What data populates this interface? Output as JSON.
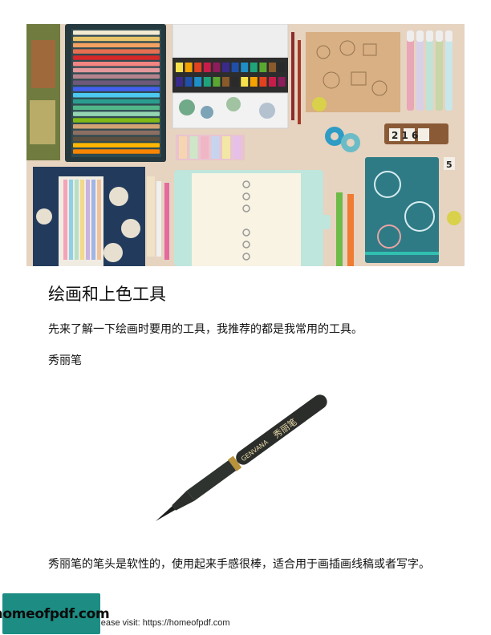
{
  "content": {
    "heading": "绘画和上色工具",
    "intro": "先来了解一下绘画时要用的工具，我推荐的都是我常用的工具。",
    "pen_name": "秀丽笔",
    "pen_description": "秀丽笔的笔头是软性的，使用起来手感很棒，适合用于画插画线稿或者写字。"
  },
  "pen_image": {
    "brand_text": "GENVANA",
    "label_chars": "秀丽笔"
  },
  "hero_image": {
    "calendar_digits": "2 1 6",
    "number_tag": "5"
  },
  "footer": {
    "text": "e please visit: https://homeofpdf.com",
    "badge_label": "homeofpdf.com"
  },
  "colors": {
    "badge": "#1d8d83",
    "hero_background": "#e9d7c4"
  }
}
